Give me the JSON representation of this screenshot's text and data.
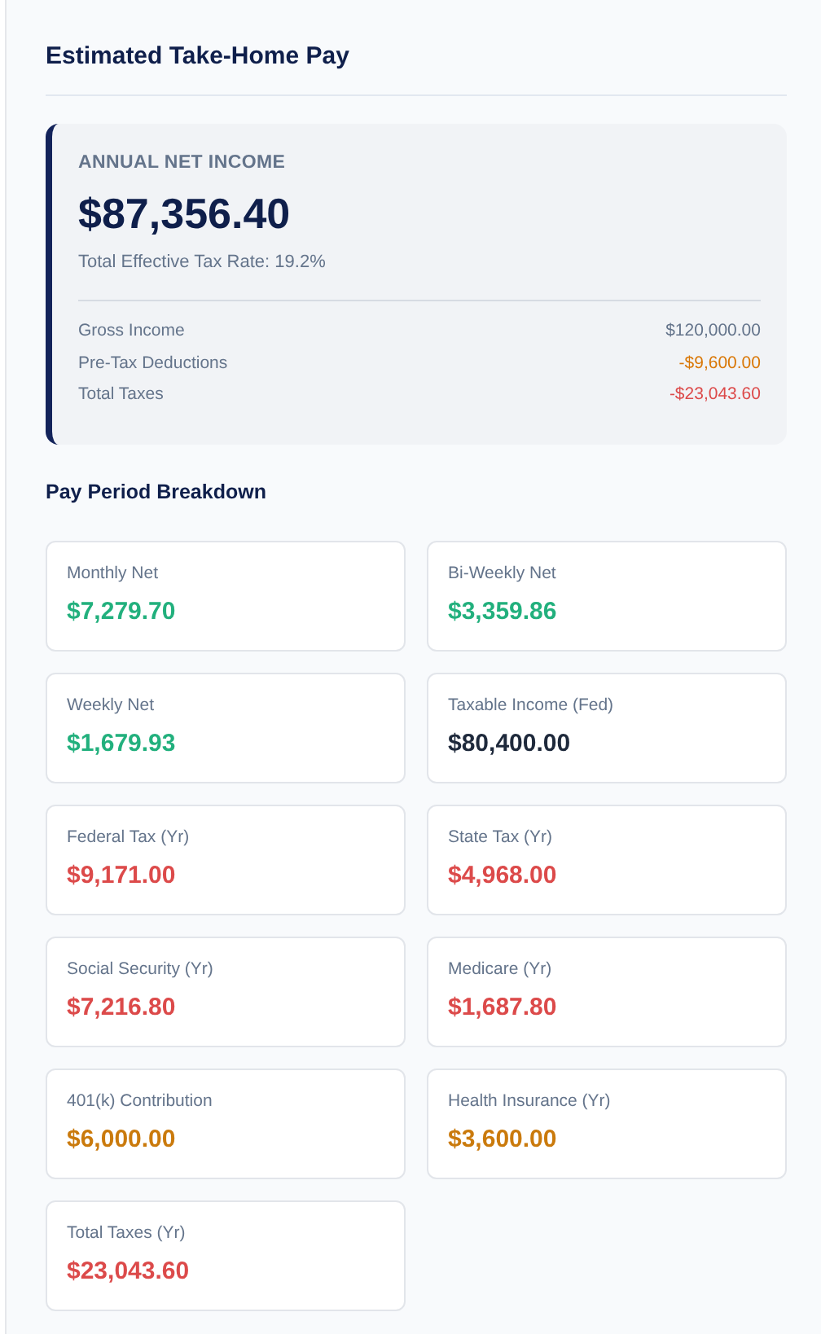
{
  "title": "Estimated Take-Home Pay",
  "summary": {
    "label": "ANNUAL NET INCOME",
    "amount": "$87,356.40",
    "rate": "Total Effective Tax Rate: 19.2%",
    "rows": [
      {
        "label": "Gross Income",
        "value": "$120,000.00",
        "color": "#64748b"
      },
      {
        "label": "Pre-Tax Deductions",
        "value": "-$9,600.00",
        "color": "#d97706"
      },
      {
        "label": "Total Taxes",
        "value": "-$23,043.60",
        "color": "#dc4a4a"
      }
    ]
  },
  "breakdown": {
    "heading": "Pay Period Breakdown",
    "cards": [
      {
        "label": "Monthly Net",
        "value": "$7,279.70",
        "color": "#22b07d"
      },
      {
        "label": "Bi-Weekly Net",
        "value": "$3,359.86",
        "color": "#22b07d"
      },
      {
        "label": "Weekly Net",
        "value": "$1,679.93",
        "color": "#22b07d"
      },
      {
        "label": "Taxable Income (Fed)",
        "value": "$80,400.00",
        "color": "#1e293b"
      },
      {
        "label": "Federal Tax (Yr)",
        "value": "$9,171.00",
        "color": "#dc4a4a"
      },
      {
        "label": "State Tax (Yr)",
        "value": "$4,968.00",
        "color": "#dc4a4a"
      },
      {
        "label": "Social Security (Yr)",
        "value": "$7,216.80",
        "color": "#dc4a4a"
      },
      {
        "label": "Medicare (Yr)",
        "value": "$1,687.80",
        "color": "#dc4a4a"
      },
      {
        "label": "401(k) Contribution",
        "value": "$6,000.00",
        "color": "#ca7a0c"
      },
      {
        "label": "Health Insurance (Yr)",
        "value": "$3,600.00",
        "color": "#ca7a0c"
      },
      {
        "label": "Total Taxes (Yr)",
        "value": "$23,043.60",
        "color": "#dc4a4a"
      }
    ]
  }
}
